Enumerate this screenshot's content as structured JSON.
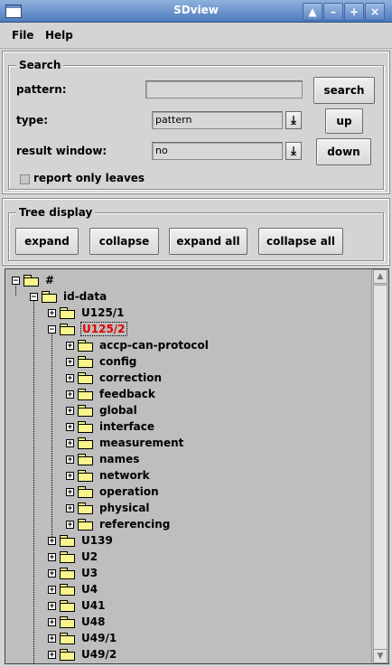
{
  "window": {
    "title": "SDview"
  },
  "menu": {
    "file": "File",
    "help": "Help"
  },
  "search": {
    "group_title": "Search",
    "pattern_label": "pattern:",
    "pattern_value": "",
    "type_label": "type:",
    "type_value": "pattern",
    "result_window_label": "result window:",
    "result_window_value": "no",
    "report_only_leaves_label": "report only leaves",
    "search_button": "search",
    "up_button": "up",
    "down_button": "down"
  },
  "tree_display": {
    "group_title": "Tree display",
    "expand": "expand",
    "collapse": "collapse",
    "expand_all": "expand all",
    "collapse_all": "collapse all"
  },
  "tree": {
    "root": "#",
    "id_data": "id-data",
    "nodes": [
      "U125/1",
      "U125/2",
      "accp-can-protocol",
      "config",
      "correction",
      "feedback",
      "global",
      "interface",
      "measurement",
      "names",
      "network",
      "operation",
      "physical",
      "referencing",
      "U139",
      "U2",
      "U3",
      "U4",
      "U41",
      "U48",
      "U49/1",
      "U49/2"
    ],
    "selected_node": "U125/2"
  },
  "colors": {
    "selected_text": "#e00000",
    "titlebar": "#5a84c2",
    "folder": "#f9f48c"
  }
}
